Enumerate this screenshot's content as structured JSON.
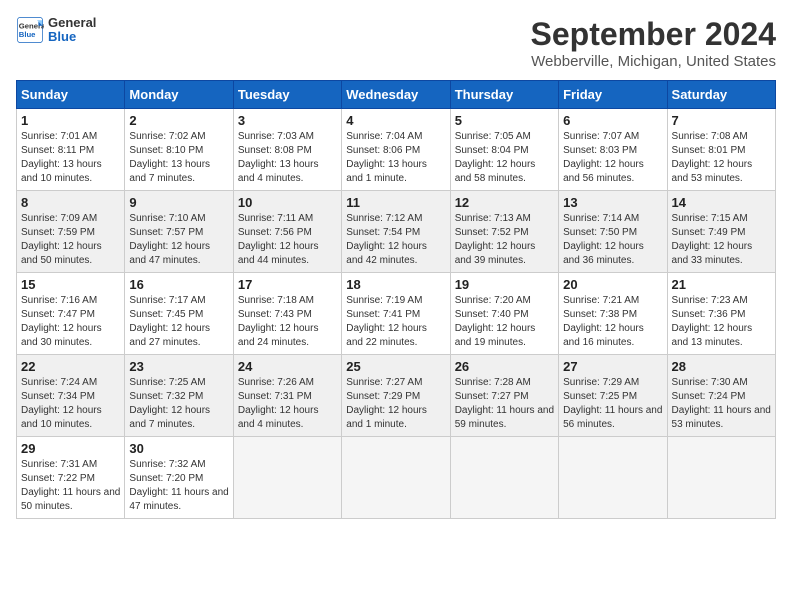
{
  "logo": {
    "line1": "General",
    "line2": "Blue"
  },
  "title": "September 2024",
  "subtitle": "Webberville, Michigan, United States",
  "headers": [
    "Sunday",
    "Monday",
    "Tuesday",
    "Wednesday",
    "Thursday",
    "Friday",
    "Saturday"
  ],
  "weeks": [
    [
      {
        "day": "1",
        "sunrise": "7:01 AM",
        "sunset": "8:11 PM",
        "daylight": "13 hours and 10 minutes."
      },
      {
        "day": "2",
        "sunrise": "7:02 AM",
        "sunset": "8:10 PM",
        "daylight": "13 hours and 7 minutes."
      },
      {
        "day": "3",
        "sunrise": "7:03 AM",
        "sunset": "8:08 PM",
        "daylight": "13 hours and 4 minutes."
      },
      {
        "day": "4",
        "sunrise": "7:04 AM",
        "sunset": "8:06 PM",
        "daylight": "13 hours and 1 minute."
      },
      {
        "day": "5",
        "sunrise": "7:05 AM",
        "sunset": "8:04 PM",
        "daylight": "12 hours and 58 minutes."
      },
      {
        "day": "6",
        "sunrise": "7:07 AM",
        "sunset": "8:03 PM",
        "daylight": "12 hours and 56 minutes."
      },
      {
        "day": "7",
        "sunrise": "7:08 AM",
        "sunset": "8:01 PM",
        "daylight": "12 hours and 53 minutes."
      }
    ],
    [
      {
        "day": "8",
        "sunrise": "7:09 AM",
        "sunset": "7:59 PM",
        "daylight": "12 hours and 50 minutes."
      },
      {
        "day": "9",
        "sunrise": "7:10 AM",
        "sunset": "7:57 PM",
        "daylight": "12 hours and 47 minutes."
      },
      {
        "day": "10",
        "sunrise": "7:11 AM",
        "sunset": "7:56 PM",
        "daylight": "12 hours and 44 minutes."
      },
      {
        "day": "11",
        "sunrise": "7:12 AM",
        "sunset": "7:54 PM",
        "daylight": "12 hours and 42 minutes."
      },
      {
        "day": "12",
        "sunrise": "7:13 AM",
        "sunset": "7:52 PM",
        "daylight": "12 hours and 39 minutes."
      },
      {
        "day": "13",
        "sunrise": "7:14 AM",
        "sunset": "7:50 PM",
        "daylight": "12 hours and 36 minutes."
      },
      {
        "day": "14",
        "sunrise": "7:15 AM",
        "sunset": "7:49 PM",
        "daylight": "12 hours and 33 minutes."
      }
    ],
    [
      {
        "day": "15",
        "sunrise": "7:16 AM",
        "sunset": "7:47 PM",
        "daylight": "12 hours and 30 minutes."
      },
      {
        "day": "16",
        "sunrise": "7:17 AM",
        "sunset": "7:45 PM",
        "daylight": "12 hours and 27 minutes."
      },
      {
        "day": "17",
        "sunrise": "7:18 AM",
        "sunset": "7:43 PM",
        "daylight": "12 hours and 24 minutes."
      },
      {
        "day": "18",
        "sunrise": "7:19 AM",
        "sunset": "7:41 PM",
        "daylight": "12 hours and 22 minutes."
      },
      {
        "day": "19",
        "sunrise": "7:20 AM",
        "sunset": "7:40 PM",
        "daylight": "12 hours and 19 minutes."
      },
      {
        "day": "20",
        "sunrise": "7:21 AM",
        "sunset": "7:38 PM",
        "daylight": "12 hours and 16 minutes."
      },
      {
        "day": "21",
        "sunrise": "7:23 AM",
        "sunset": "7:36 PM",
        "daylight": "12 hours and 13 minutes."
      }
    ],
    [
      {
        "day": "22",
        "sunrise": "7:24 AM",
        "sunset": "7:34 PM",
        "daylight": "12 hours and 10 minutes."
      },
      {
        "day": "23",
        "sunrise": "7:25 AM",
        "sunset": "7:32 PM",
        "daylight": "12 hours and 7 minutes."
      },
      {
        "day": "24",
        "sunrise": "7:26 AM",
        "sunset": "7:31 PM",
        "daylight": "12 hours and 4 minutes."
      },
      {
        "day": "25",
        "sunrise": "7:27 AM",
        "sunset": "7:29 PM",
        "daylight": "12 hours and 1 minute."
      },
      {
        "day": "26",
        "sunrise": "7:28 AM",
        "sunset": "7:27 PM",
        "daylight": "11 hours and 59 minutes."
      },
      {
        "day": "27",
        "sunrise": "7:29 AM",
        "sunset": "7:25 PM",
        "daylight": "11 hours and 56 minutes."
      },
      {
        "day": "28",
        "sunrise": "7:30 AM",
        "sunset": "7:24 PM",
        "daylight": "11 hours and 53 minutes."
      }
    ],
    [
      {
        "day": "29",
        "sunrise": "7:31 AM",
        "sunset": "7:22 PM",
        "daylight": "11 hours and 50 minutes."
      },
      {
        "day": "30",
        "sunrise": "7:32 AM",
        "sunset": "7:20 PM",
        "daylight": "11 hours and 47 minutes."
      },
      null,
      null,
      null,
      null,
      null
    ]
  ],
  "labels": {
    "sunrise": "Sunrise:",
    "sunset": "Sunset:",
    "daylight": "Daylight:"
  }
}
